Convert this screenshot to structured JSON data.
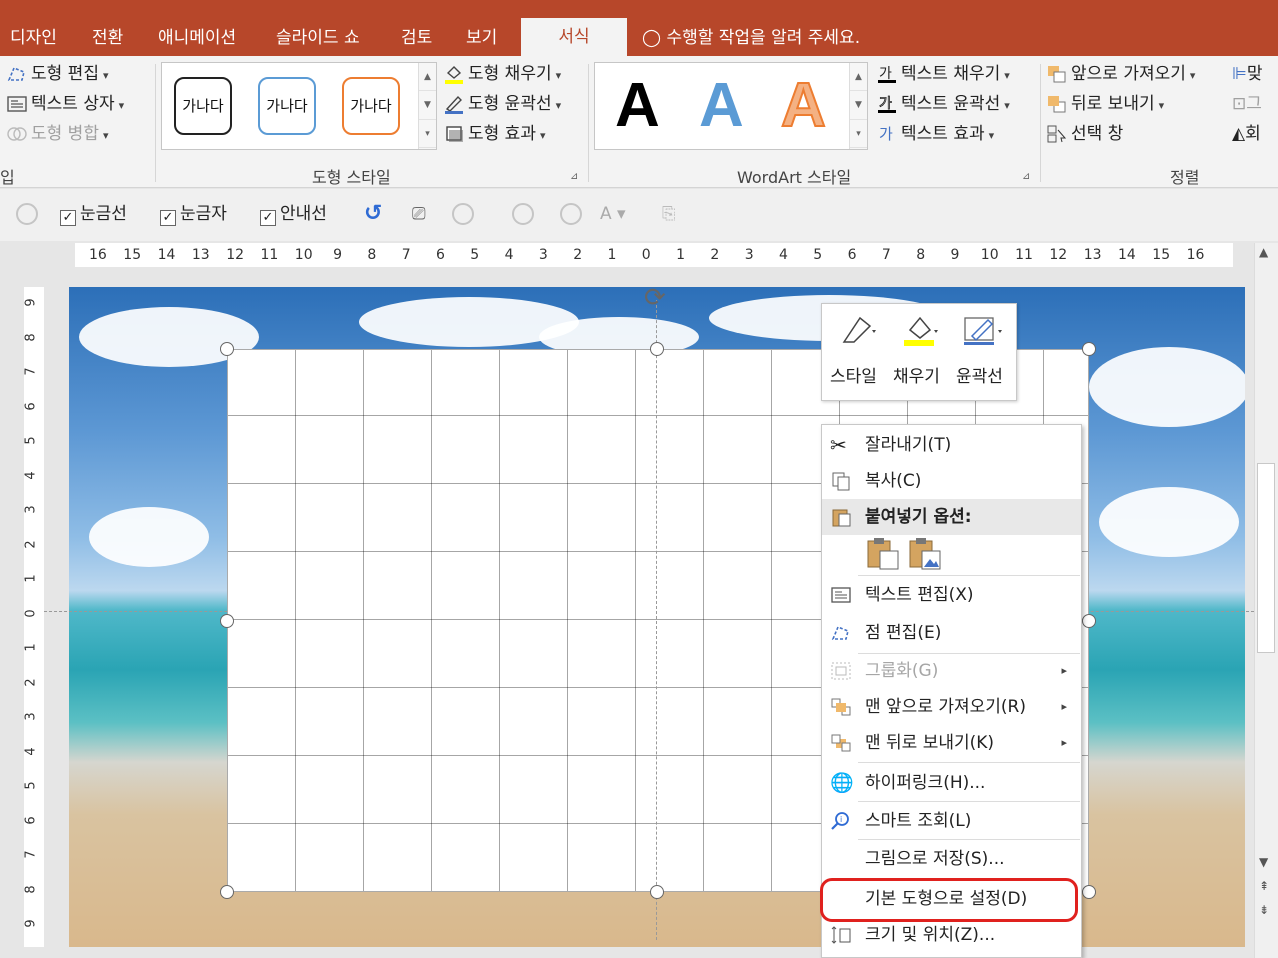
{
  "window": {
    "title_fragment": ""
  },
  "tabs": [
    "디자인",
    "전환",
    "애니메이션",
    "슬라이드 쇼",
    "검토",
    "보기"
  ],
  "active_tab": "서식",
  "tell_me": "수행할 작업을 알려 주세요.",
  "ribbon": {
    "insert_shapes": {
      "edit_shape": "도형 편집",
      "text_box": "텍스트 상자",
      "merge_shapes": "도형 병합",
      "group_label": "입"
    },
    "shape_styles": {
      "samples": [
        "가나다",
        "가나다",
        "가나다"
      ],
      "sample_colors": [
        "#222222",
        "#5b9bd5",
        "#ed7d31"
      ],
      "fill": "도형 채우기",
      "outline": "도형 윤곽선",
      "effects": "도형 효과",
      "group_label": "도형 스타일"
    },
    "wordart": {
      "samples": [
        "A",
        "A",
        "A"
      ],
      "sample_colors": [
        "#000000",
        "#5b9bd5",
        "#ed7d31"
      ],
      "text_fill": "텍스트 채우기",
      "text_outline": "텍스트 윤곽선",
      "text_effects": "텍스트 효과",
      "group_label": "WordArt 스타일"
    },
    "arrange": {
      "bring_forward": "앞으로 가져오기",
      "send_backward": "뒤로 보내기",
      "selection_pane": "선택 창",
      "group_label": "정렬",
      "align_cut": "맞",
      "group_cut": "그",
      "rotate_cut": "회"
    }
  },
  "quickbar": {
    "gridlines": "눈금선",
    "ruler": "눈금자",
    "guides": "안내선"
  },
  "hruler_labels": [
    "16",
    "15",
    "14",
    "13",
    "12",
    "11",
    "10",
    "9",
    "8",
    "7",
    "6",
    "5",
    "4",
    "3",
    "2",
    "1",
    "0",
    "1",
    "2",
    "3",
    "4",
    "5",
    "6",
    "7",
    "8",
    "9",
    "10",
    "11",
    "12",
    "13",
    "14",
    "15",
    "16"
  ],
  "vruler_labels": [
    "9",
    "8",
    "7",
    "6",
    "5",
    "4",
    "3",
    "2",
    "1",
    "0",
    "1",
    "2",
    "3",
    "4",
    "5",
    "6",
    "7",
    "8",
    "9"
  ],
  "minibar": {
    "style": "스타일",
    "fill": "채우기",
    "outline": "윤곽선"
  },
  "context_menu": {
    "cut": "잘라내기(T)",
    "copy": "복사(C)",
    "paste_options": "붙여넣기 옵션:",
    "edit_text": "텍스트 편집(X)",
    "edit_points": "점 편집(E)",
    "group": "그룹화(G)",
    "bring_to_front": "맨 앞으로 가져오기(R)",
    "send_to_back": "맨 뒤로 보내기(K)",
    "hyperlink": "하이퍼링크(H)...",
    "smart_lookup": "스마트 조회(L)",
    "save_as_picture": "그림으로 저장(S)...",
    "set_default_shape": "기본 도형으로 설정(D)",
    "size_position": "크기 및 위치(Z)..."
  },
  "colors": {
    "accent": "#b7472a",
    "highlight_ring": "#e0211e"
  }
}
